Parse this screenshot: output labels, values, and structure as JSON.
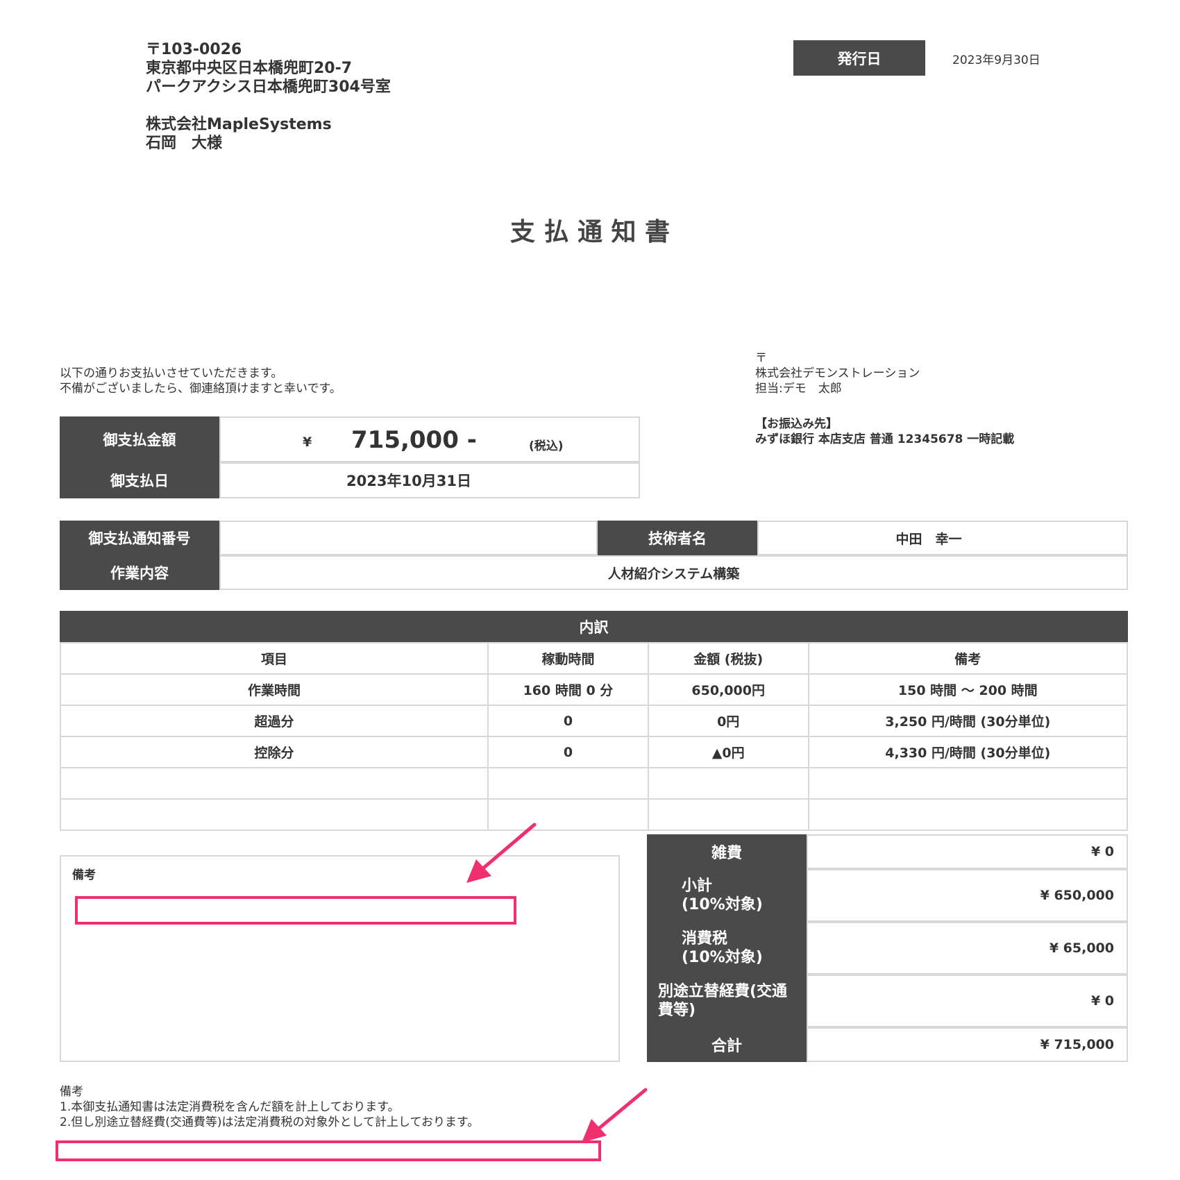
{
  "recipient": {
    "postal": "〒103-0026",
    "address1": "東京都中央区日本橋兜町20-7",
    "address2": "パークアクシス日本橋兜町304号室",
    "company": "株式会社MapleSystems",
    "person": "石岡　大様"
  },
  "issue": {
    "label": "発行日",
    "date": "2023年9月30日"
  },
  "title": "支 払 通 知 書",
  "intro": {
    "line1": "以下の通りお支払いさせていただきます。",
    "line2": "不備がございましたら、御連絡頂けますと幸いです。"
  },
  "issuer": {
    "postal": "〒",
    "company": "株式会社デモンストレーション",
    "contact": "担当:デモ　太郎",
    "bank_label": "【お振込み先】",
    "bank_info": "みずほ銀行 本店支店 普通 12345678 一時記載"
  },
  "payment": {
    "amount_label": "御支払金額",
    "currency": "¥",
    "amount": "715,000 -",
    "tax_note": "(税込)",
    "date_label": "御支払日",
    "date": "2023年10月31日"
  },
  "info": {
    "notice_no_label": "御支払通知番号",
    "notice_no": "",
    "engineer_label": "技術者名",
    "engineer": "中田　幸一",
    "work_label": "作業内容",
    "work": "人材紹介システム構築"
  },
  "breakdown": {
    "header": "内訳",
    "columns": [
      "項目",
      "稼動時間",
      "金額 (税抜)",
      "備考"
    ],
    "rows": [
      [
        "作業時間",
        "160 時間 0 分",
        "650,000円",
        "150 時間 〜 200 時間"
      ],
      [
        "超過分",
        "0",
        "0円",
        "3,250 円/時間 (30分単位)"
      ],
      [
        "控除分",
        "0",
        "▲0円",
        "4,330 円/時間 (30分単位)"
      ],
      [
        "",
        "",
        "",
        ""
      ],
      [
        "",
        "",
        "",
        ""
      ]
    ]
  },
  "remarks_box": {
    "label": "備考"
  },
  "summary": [
    {
      "label": "雑費",
      "value": "¥ 0"
    },
    {
      "label": "小計\n(10%対象)",
      "value": "¥ 650,000"
    },
    {
      "label": "消費税\n(10%対象)",
      "value": "¥ 65,000"
    },
    {
      "label": "別途立替経費(交通費等)",
      "value": "¥ 0"
    },
    {
      "label": "合計",
      "value": "¥ 715,000"
    }
  ],
  "notes": {
    "title": "備考",
    "line1": "1.本御支払通知書は法定消費税を含んだ額を計上しております。",
    "line2": "2.但し別途立替経費(交通費等)は法定消費税の対象外として計上しております。"
  },
  "colors": {
    "header_bg": "#4a4a4a",
    "border": "#d8d8d8",
    "annotation": "#f0306e"
  }
}
